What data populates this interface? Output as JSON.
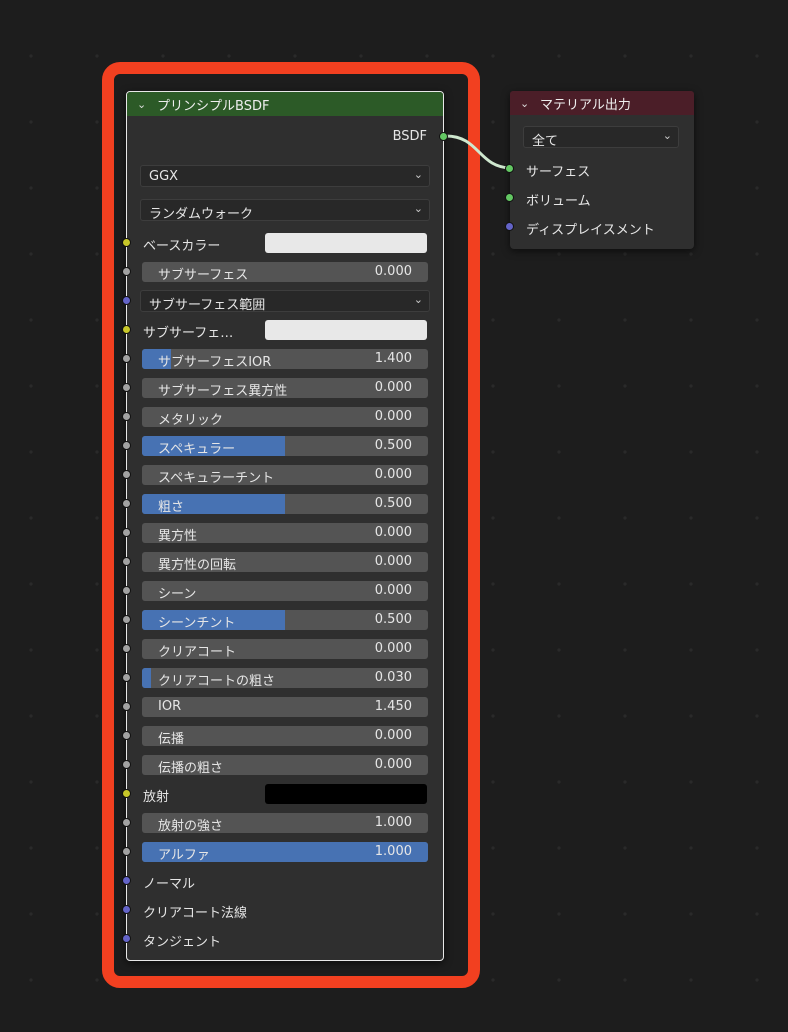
{
  "bsdf_node": {
    "title": "プリンシプルBSDF",
    "output_label": "BSDF",
    "distribution": "GGX",
    "subsurface_method": "ランダムウォーク",
    "inputs": [
      {
        "type": "color",
        "label": "ベースカラー",
        "color": "#e8e8e8",
        "socket": "yellow"
      },
      {
        "type": "value",
        "label": "サブサーフェス",
        "value": "0.000",
        "fill": 0.0,
        "socket": "grey"
      },
      {
        "type": "dropdown",
        "label": "サブサーフェス範囲",
        "socket": "blue"
      },
      {
        "type": "color",
        "label": "サブサーフェ…",
        "color": "#e8e8e8",
        "socket": "yellow"
      },
      {
        "type": "value",
        "label": "サブサーフェスIOR",
        "value": "1.400",
        "fill": 0.1,
        "socket": "grey"
      },
      {
        "type": "value",
        "label": "サブサーフェス異方性",
        "value": "0.000",
        "fill": 0.0,
        "socket": "grey"
      },
      {
        "type": "value",
        "label": "メタリック",
        "value": "0.000",
        "fill": 0.0,
        "socket": "grey"
      },
      {
        "type": "value",
        "label": "スペキュラー",
        "value": "0.500",
        "fill": 0.5,
        "socket": "grey"
      },
      {
        "type": "value",
        "label": "スペキュラーチント",
        "value": "0.000",
        "fill": 0.0,
        "socket": "grey"
      },
      {
        "type": "value",
        "label": "粗さ",
        "value": "0.500",
        "fill": 0.5,
        "socket": "grey"
      },
      {
        "type": "value",
        "label": "異方性",
        "value": "0.000",
        "fill": 0.0,
        "socket": "grey"
      },
      {
        "type": "value",
        "label": "異方性の回転",
        "value": "0.000",
        "fill": 0.0,
        "socket": "grey"
      },
      {
        "type": "value",
        "label": "シーン",
        "value": "0.000",
        "fill": 0.0,
        "socket": "grey"
      },
      {
        "type": "value",
        "label": "シーンチント",
        "value": "0.500",
        "fill": 0.5,
        "socket": "grey"
      },
      {
        "type": "value",
        "label": "クリアコート",
        "value": "0.000",
        "fill": 0.0,
        "socket": "grey"
      },
      {
        "type": "value",
        "label": "クリアコートの粗さ",
        "value": "0.030",
        "fill": 0.03,
        "socket": "grey"
      },
      {
        "type": "value",
        "label": "IOR",
        "value": "1.450",
        "fill": 0.0,
        "socket": "grey"
      },
      {
        "type": "value",
        "label": "伝播",
        "value": "0.000",
        "fill": 0.0,
        "socket": "grey"
      },
      {
        "type": "value",
        "label": "伝播の粗さ",
        "value": "0.000",
        "fill": 0.0,
        "socket": "grey"
      },
      {
        "type": "color",
        "label": "放射",
        "color": "#000000",
        "socket": "yellow"
      },
      {
        "type": "value",
        "label": "放射の強さ",
        "value": "1.000",
        "fill": 0.0,
        "socket": "grey"
      },
      {
        "type": "value",
        "label": "アルファ",
        "value": "1.000",
        "fill": 1.0,
        "socket": "grey"
      },
      {
        "type": "plain",
        "label": "ノーマル",
        "socket": "blue"
      },
      {
        "type": "plain",
        "label": "クリアコート法線",
        "socket": "blue"
      },
      {
        "type": "plain",
        "label": "タンジェント",
        "socket": "blue"
      }
    ]
  },
  "output_node": {
    "title": "マテリアル出力",
    "target": "全て",
    "inputs": [
      {
        "label": "サーフェス",
        "socket": "green"
      },
      {
        "label": "ボリューム",
        "socket": "green"
      },
      {
        "label": "ディスプレイスメント",
        "socket": "blue"
      }
    ]
  },
  "colors": {
    "highlight": "#f24020",
    "bsdf_header": "#2c5a27",
    "output_header": "#4b1e28",
    "slider_fill": "#4772b3",
    "socket_green": "#63c763",
    "socket_yellow": "#c7c729",
    "socket_grey": "#a1a1a1",
    "socket_blue": "#6363c7"
  },
  "icons": {
    "collapse": "chevron-down-icon",
    "dropdown": "chevron-down-icon"
  }
}
